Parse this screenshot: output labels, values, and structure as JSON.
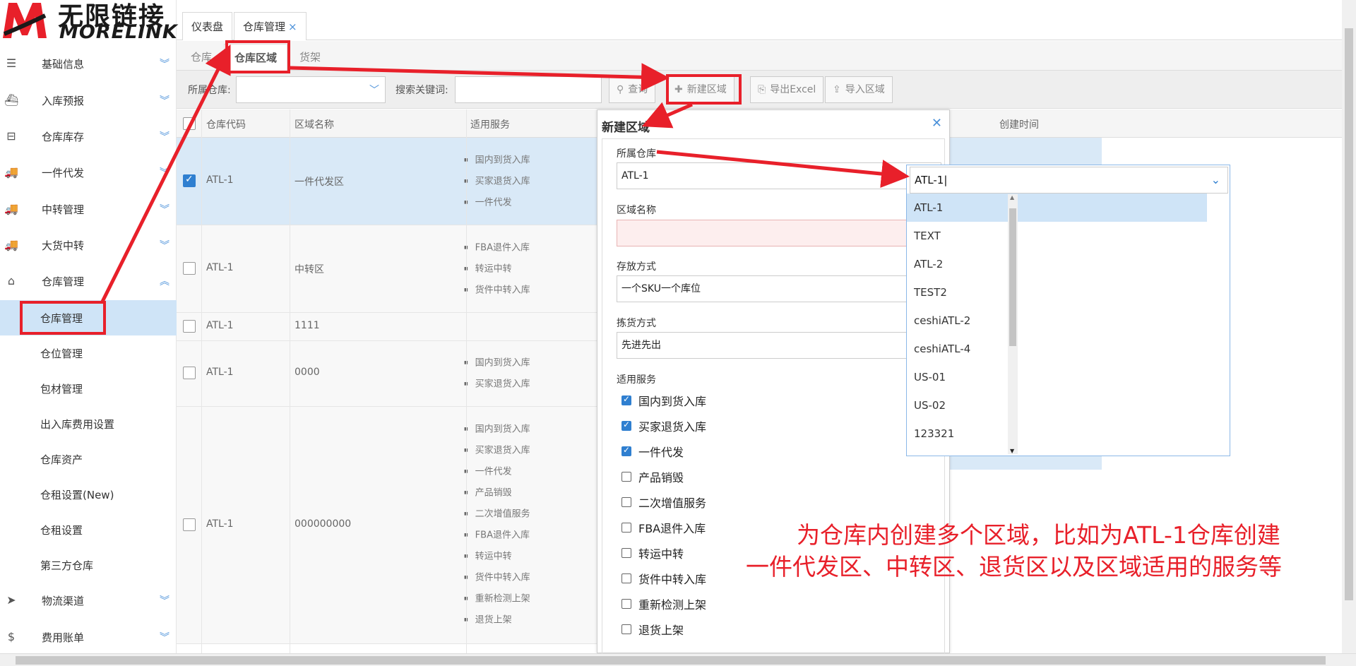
{
  "logo": {
    "cn": "无限链接",
    "en": "MORELINK"
  },
  "sidebar": {
    "menus": [
      {
        "icon": "list-icon",
        "label": "基础信息"
      },
      {
        "icon": "ship-icon",
        "label": "入库预报"
      },
      {
        "icon": "inbox-icon",
        "label": "仓库库存"
      },
      {
        "icon": "truck-icon",
        "label": "一件代发"
      },
      {
        "icon": "truck-icon",
        "label": "中转管理"
      },
      {
        "icon": "truck-icon",
        "label": "大货中转"
      },
      {
        "icon": "home-icon",
        "label": "仓库管理"
      }
    ],
    "subitems": [
      "仓库管理",
      "仓位管理",
      "包材管理",
      "出入库费用设置",
      "仓库资产",
      "仓租设置(New)",
      "仓租设置",
      "第三方仓库"
    ],
    "menus2": [
      {
        "icon": "pointer-icon",
        "label": "物流渠道"
      },
      {
        "icon": "dollar-icon",
        "label": "费用账单"
      }
    ]
  },
  "tabs": [
    "仪表盘",
    "仓库管理"
  ],
  "subtabs": [
    "仓库",
    "仓库区域",
    "货架"
  ],
  "toolbar": {
    "warehouse_label": "所属仓库:",
    "keyword_label": "搜索关键词:",
    "query": "查询",
    "new_area": "新建区域",
    "export": "导出Excel",
    "import": "导入区域"
  },
  "table": {
    "headers": [
      "仓库代码",
      "区域名称",
      "适用服务"
    ],
    "rows": [
      {
        "code": "ATL-1",
        "name": "一件代发区",
        "services": [
          "国内到货入库",
          "买家退货入库",
          "一件代发"
        ],
        "checked": true
      },
      {
        "code": "ATL-1",
        "name": "中转区",
        "services": [
          "FBA退件入库",
          "转运中转",
          "货件中转入库"
        ],
        "checked": false
      },
      {
        "code": "ATL-1",
        "name": "1111",
        "services": [],
        "checked": false
      },
      {
        "code": "ATL-1",
        "name": "0000",
        "services": [
          "国内到货入库",
          "买家退货入库"
        ],
        "checked": false
      },
      {
        "code": "ATL-1",
        "name": "000000000",
        "services": [
          "国内到货入库",
          "买家退货入库",
          "一件代发",
          "产品销毁",
          "二次增值服务",
          "FBA退件入库",
          "转运中转",
          "货件中转入库",
          "重新检测上架",
          "退货上架"
        ],
        "checked": false
      }
    ],
    "right_header": "创建时间"
  },
  "dialog": {
    "title": "新建区域",
    "warehouse_label": "所属仓库",
    "warehouse_value": "ATL-1",
    "area_label": "区域名称",
    "storage_label": "存放方式",
    "storage_value": "一个SKU一个库位",
    "picking_label": "拣货方式",
    "picking_value": "先进先出",
    "services_label": "适用服务",
    "services": [
      {
        "label": "国内到货入库",
        "checked": true
      },
      {
        "label": "买家退货入库",
        "checked": true
      },
      {
        "label": "一件代发",
        "checked": true
      },
      {
        "label": "产品销毁",
        "checked": false
      },
      {
        "label": "二次增值服务",
        "checked": false
      },
      {
        "label": "FBA退件入库",
        "checked": false
      },
      {
        "label": "转运中转",
        "checked": false
      },
      {
        "label": "货件中转入库",
        "checked": false
      },
      {
        "label": "重新检测上架",
        "checked": false
      },
      {
        "label": "退货上架",
        "checked": false
      }
    ]
  },
  "dropdown": {
    "value": "ATL-1",
    "options": [
      "ATL-1",
      "TEXT",
      "ATL-2",
      "TEST2",
      "ceshiATL-2",
      "ceshiATL-4",
      "US-01",
      "US-02",
      "123321"
    ]
  },
  "annotation": {
    "line1": "为仓库内创建多个区域，比如为ATL-1仓库创建",
    "line2": "一件代发区、中转区、退货区以及区域适用的服务等"
  },
  "colors": {
    "accent": "#e8202a",
    "primary": "#2f7fd0",
    "selected_row": "#d9e9f7"
  }
}
